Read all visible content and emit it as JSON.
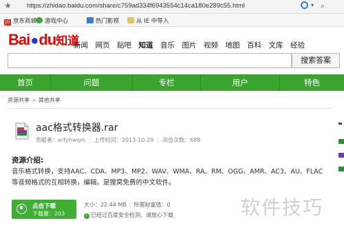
{
  "browser": {
    "url": "https://zhidao.baidu.com/share/c759ad334f6943554c14ca180e289c55.html",
    "icons": [
      "star-icon",
      "ie-icon",
      "search-icon"
    ]
  },
  "bookmarks": [
    {
      "label": "京东商城",
      "icon": "jd-icon",
      "color": "#d6261f"
    },
    {
      "label": "游戏中心",
      "icon": "game-icon",
      "color": "#3aa33a"
    },
    {
      "label": "热门影视",
      "icon": "video-icon",
      "color": "#2f7fd6"
    },
    {
      "label": "从 IE 中导入",
      "icon": "folder-icon",
      "color": "#e8c15b"
    }
  ],
  "header": {
    "logo_bai": "Bai",
    "logo_du": "du",
    "logo_zhidao": "知道",
    "nav": [
      "新闻",
      "网页",
      "贴吧",
      "知道",
      "音乐",
      "图片",
      "视频",
      "地图",
      "百科",
      "文库",
      "经验"
    ],
    "active_nav": "知道"
  },
  "search": {
    "value": "",
    "button_label": "搜索答案"
  },
  "green_nav": [
    "首页",
    "问题",
    "专栏",
    "用户",
    "特色"
  ],
  "breadcrumb": [
    "资源共享",
    "其他共享"
  ],
  "file": {
    "title": "aac格式转换器.rar",
    "uploader_label": "贡献者：",
    "uploader": "erfyhwqm",
    "upload_label": "上传时间：",
    "upload_time": "2013-10-29",
    "views_label": "浏览次数：",
    "views": "688"
  },
  "intro": {
    "heading": "资源介绍:",
    "body": "音乐格式转换，支持AAC、CDA、MP3、MP2、WAV、WMA、RA、RM、OGG、AMR、AC3、AU、FLAC等音频格式的互相转换，编辑。是狸窝免费的中文软件。"
  },
  "download": {
    "button_label": "点击下载",
    "count_label": "下载量：",
    "count": "203",
    "size_label": "大小：",
    "size": "22.44 MB",
    "wealth_label": "所需财富值：",
    "wealth": "0",
    "safety_text": "已经过百度安全检测，请放心下载"
  },
  "watermark": "软件技巧",
  "colors": {
    "brand_red": "#e10602",
    "brand_blue": "#2932e1",
    "nav_green": "#39a52e",
    "download_green": "#3fae35"
  }
}
